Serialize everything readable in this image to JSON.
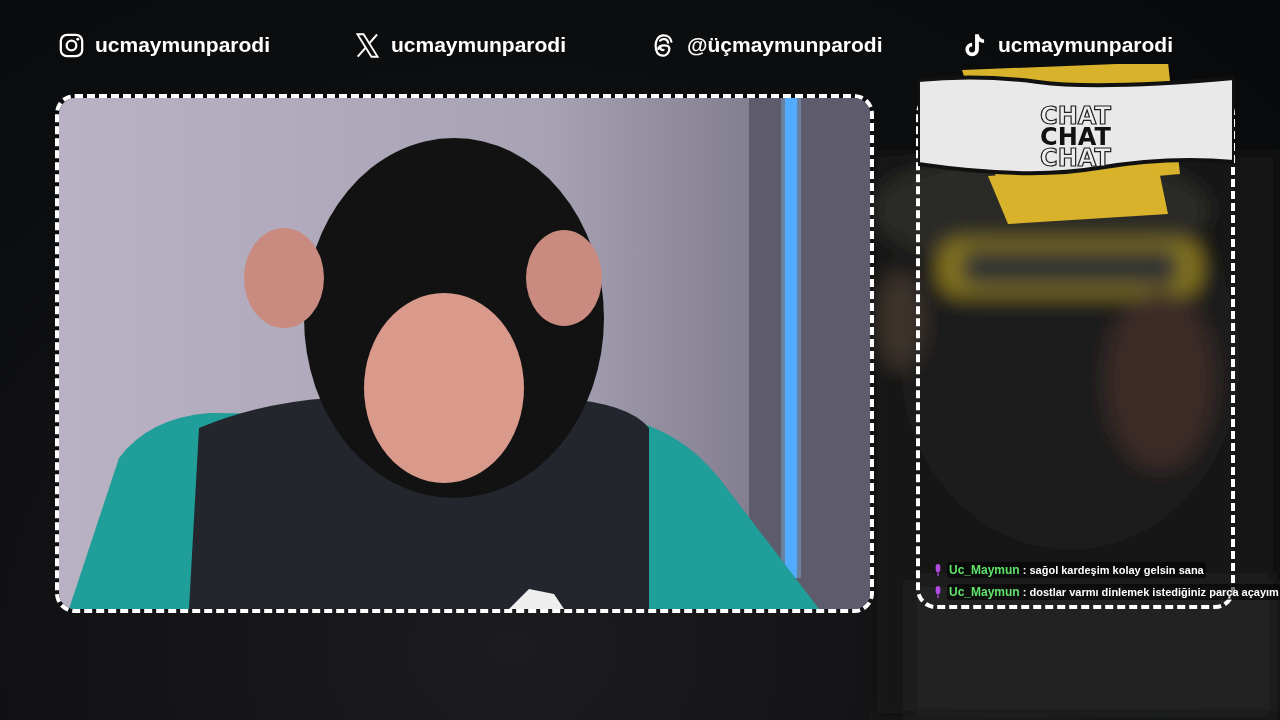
{
  "socials": [
    {
      "kind": "instagram",
      "handle": "ucmaymunparodi"
    },
    {
      "kind": "x",
      "handle": "ucmaymunparodi"
    },
    {
      "kind": "threads",
      "handle": "@üçmaymunparodi"
    },
    {
      "kind": "tiktok",
      "handle": "ucmaymunparodi"
    }
  ],
  "chat": {
    "header_words": [
      {
        "text": "CHAT",
        "outlined": true
      },
      {
        "text": "CHAT",
        "outlined": false
      },
      {
        "text": "CHAT",
        "outlined": true
      }
    ],
    "messages": [
      {
        "user": "Uc_Maymun",
        "text": ": sağol kardeşim kolay gelsin sana"
      },
      {
        "user": "Uc_Maymun",
        "text": ": dostlar varmı dinlemek istediğiniz parça açayım"
      }
    ]
  }
}
